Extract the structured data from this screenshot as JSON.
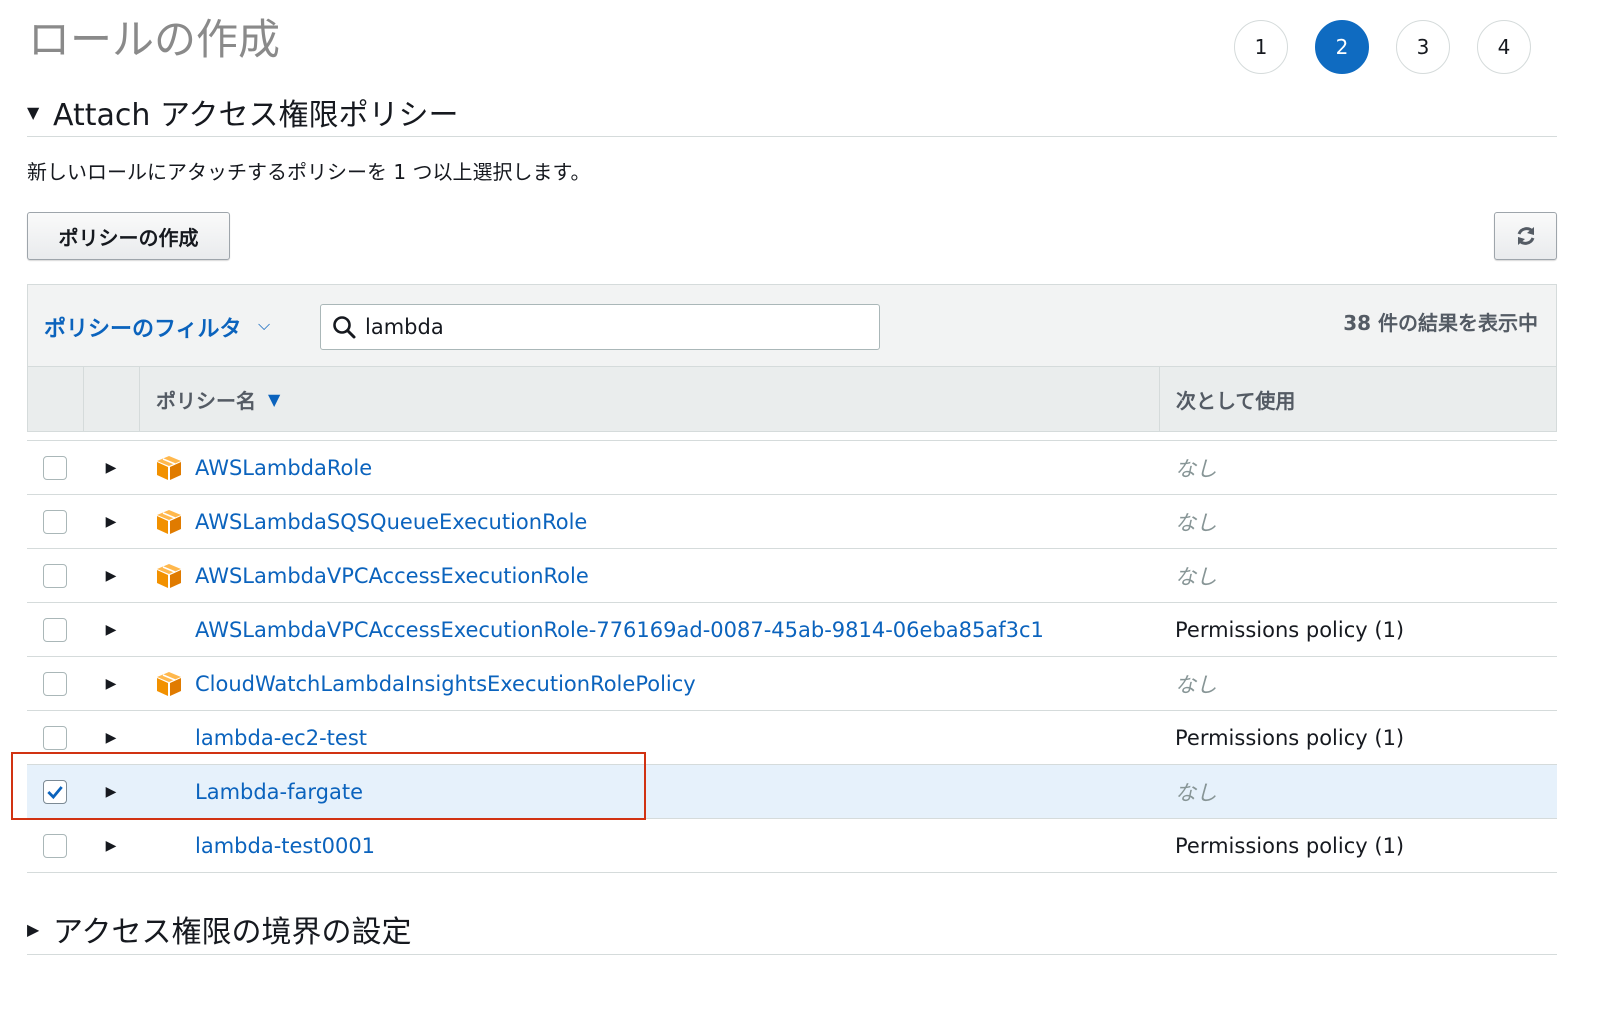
{
  "page": {
    "title": "ロールの作成"
  },
  "steps": [
    "1",
    "2",
    "3",
    "4"
  ],
  "attach_section": {
    "title": "Attach アクセス権限ポリシー",
    "description": "新しいロールにアタッチするポリシーを 1 つ以上選択します。",
    "create_button": "ポリシーの作成"
  },
  "filter": {
    "label": "ポリシーのフィルタ",
    "search_value": "lambda",
    "result_count": "38 件の結果を表示中"
  },
  "columns": {
    "name": "ポリシー名",
    "usage": "次として使用"
  },
  "rows": [
    {
      "name": "AWSLambdaRole",
      "usage": "なし",
      "aws_managed": true,
      "checked": false
    },
    {
      "name": "AWSLambdaSQSQueueExecutionRole",
      "usage": "なし",
      "aws_managed": true,
      "checked": false
    },
    {
      "name": "AWSLambdaVPCAccessExecutionRole",
      "usage": "なし",
      "aws_managed": true,
      "checked": false
    },
    {
      "name": "AWSLambdaVPCAccessExecutionRole-776169ad-0087-45ab-9814-06eba85af3c1",
      "usage": "Permissions policy (1)",
      "aws_managed": false,
      "checked": false
    },
    {
      "name": "CloudWatchLambdaInsightsExecutionRolePolicy",
      "usage": "なし",
      "aws_managed": true,
      "checked": false
    },
    {
      "name": "lambda-ec2-test",
      "usage": "Permissions policy (1)",
      "aws_managed": false,
      "checked": false
    },
    {
      "name": "Lambda-fargate",
      "usage": "なし",
      "aws_managed": false,
      "checked": true
    },
    {
      "name": "lambda-test0001",
      "usage": "Permissions policy (1)",
      "aws_managed": false,
      "checked": false
    }
  ],
  "boundary_section": {
    "title": "アクセス権限の境界の設定"
  },
  "colors": {
    "accent": "#0f6bc1",
    "link": "#0b63bd",
    "highlight_border": "#d13212",
    "aws_icon": "#f29100"
  }
}
